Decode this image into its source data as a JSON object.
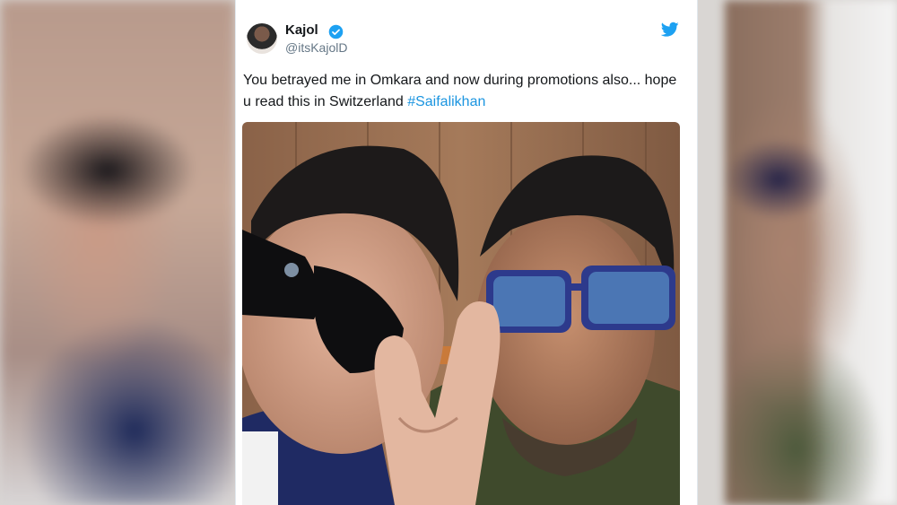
{
  "tweet": {
    "author_name": "Kajol",
    "author_handle": "@itsKajolD",
    "text": "You betrayed me in Omkara and now during promotions also... hope u read this in Switzerland ",
    "hashtag": "#Saifalikhan"
  },
  "icons": {
    "verified": "verified-badge-icon",
    "platform": "twitter-bird-icon"
  },
  "colors": {
    "link": "#1b95e0",
    "verified": "#1da1f2",
    "text": "#14171a",
    "muted": "#657786"
  }
}
